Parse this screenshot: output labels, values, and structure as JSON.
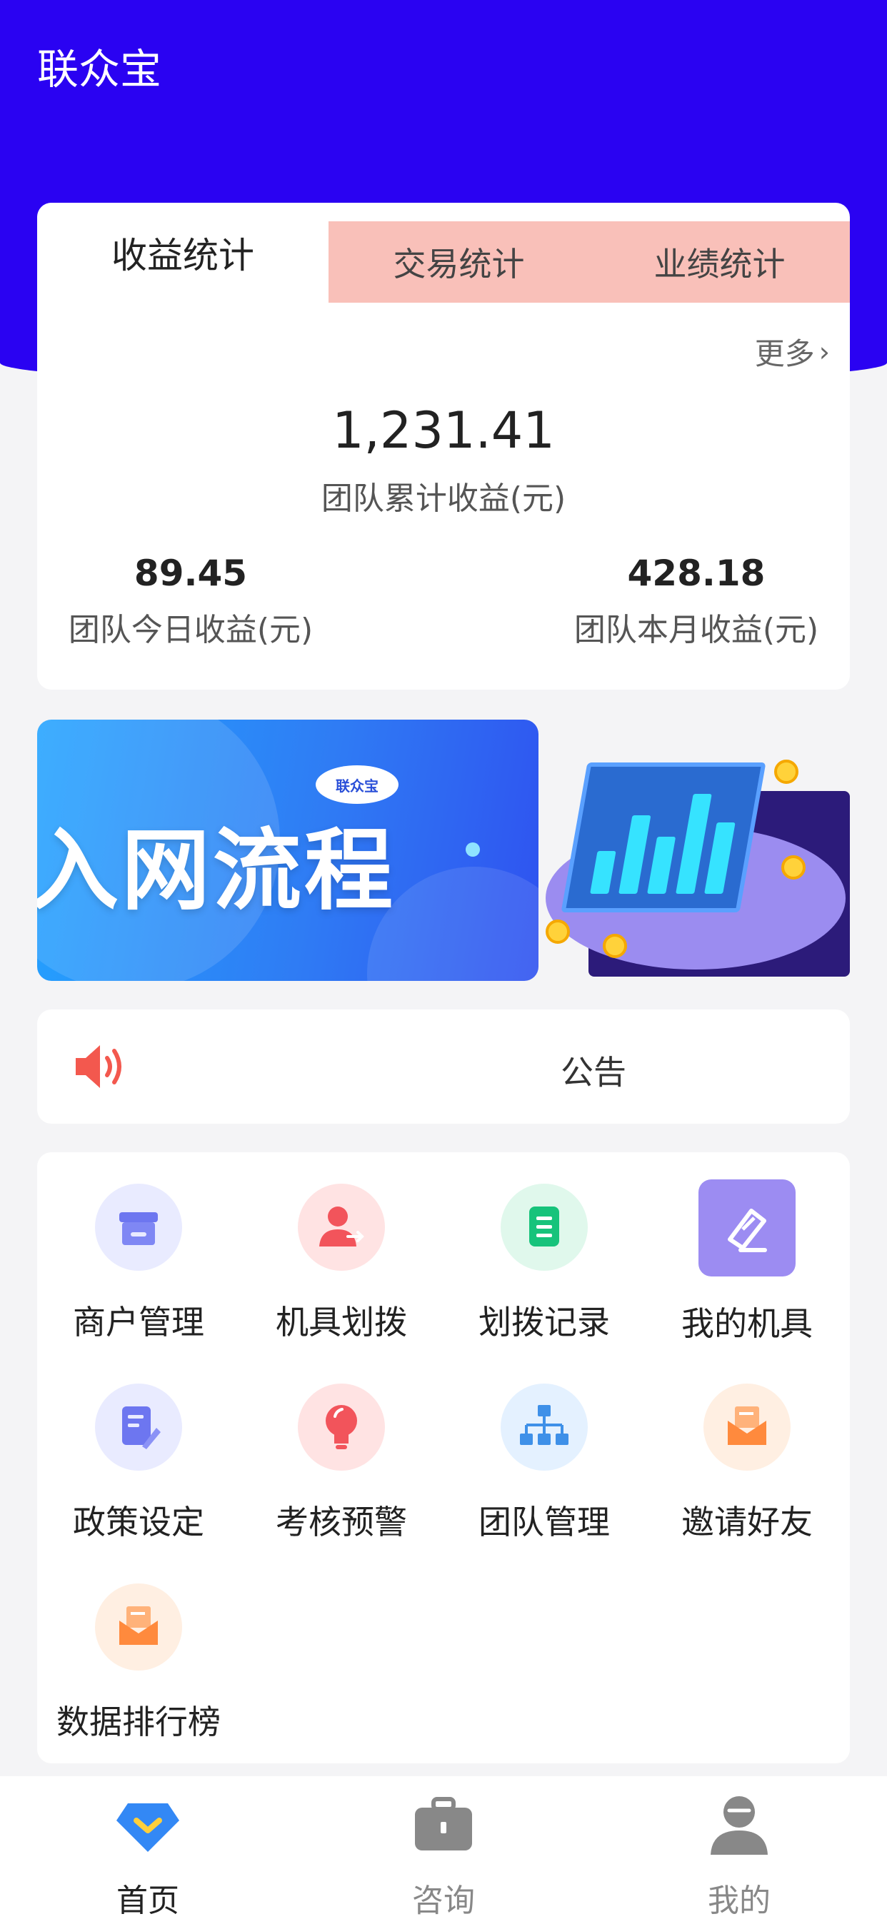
{
  "app": {
    "title": "联众宝"
  },
  "stats": {
    "tabs": [
      {
        "label": "收益统计",
        "active": true
      },
      {
        "label": "交易统计",
        "active": false
      },
      {
        "label": "业绩统计",
        "active": false
      }
    ],
    "more_label": "更多",
    "total": {
      "value": "1,231.41",
      "label": "团队累计收益(元)"
    },
    "today": {
      "value": "89.45",
      "label": "团队今日收益(元)"
    },
    "month": {
      "value": "428.18",
      "label": "团队本月收益(元)"
    }
  },
  "banner": {
    "slide1_title": "入网流程",
    "slide1_logo": "联众宝"
  },
  "notice": {
    "label": "公告"
  },
  "menu": [
    {
      "label": "商户管理",
      "icon": "store-icon",
      "bg": "#e9ebff",
      "fg": "#6d76f0"
    },
    {
      "label": "机具划拨",
      "icon": "user-transfer-icon",
      "bg": "#ffe3e3",
      "fg": "#f2545b"
    },
    {
      "label": "划拨记录",
      "icon": "document-list-icon",
      "bg": "#e0f8ec",
      "fg": "#17c37b"
    },
    {
      "label": "我的机具",
      "icon": "card-edit-icon",
      "bg": "#9c8cf2",
      "fg": "#ffffff"
    },
    {
      "label": "政策设定",
      "icon": "edit-document-icon",
      "bg": "#e9ebff",
      "fg": "#6d76f0"
    },
    {
      "label": "考核预警",
      "icon": "lightbulb-icon",
      "bg": "#ffe3e3",
      "fg": "#f2545b"
    },
    {
      "label": "团队管理",
      "icon": "org-chart-icon",
      "bg": "#e4f1ff",
      "fg": "#3e90e8"
    },
    {
      "label": "邀请好友",
      "icon": "mail-envelope-icon",
      "bg": "#ffefe2",
      "fg": "#ff8a3d"
    },
    {
      "label": "数据排行榜",
      "icon": "mail-envelope-icon",
      "bg": "#ffefe2",
      "fg": "#ff8a3d"
    }
  ],
  "tabbar": [
    {
      "label": "首页",
      "icon": "home-diamond-icon",
      "active": true,
      "color": "#3388f5"
    },
    {
      "label": "咨询",
      "icon": "briefcase-icon",
      "active": false,
      "color": "#888888"
    },
    {
      "label": "我的",
      "icon": "user-icon",
      "active": false,
      "color": "#888888"
    }
  ]
}
